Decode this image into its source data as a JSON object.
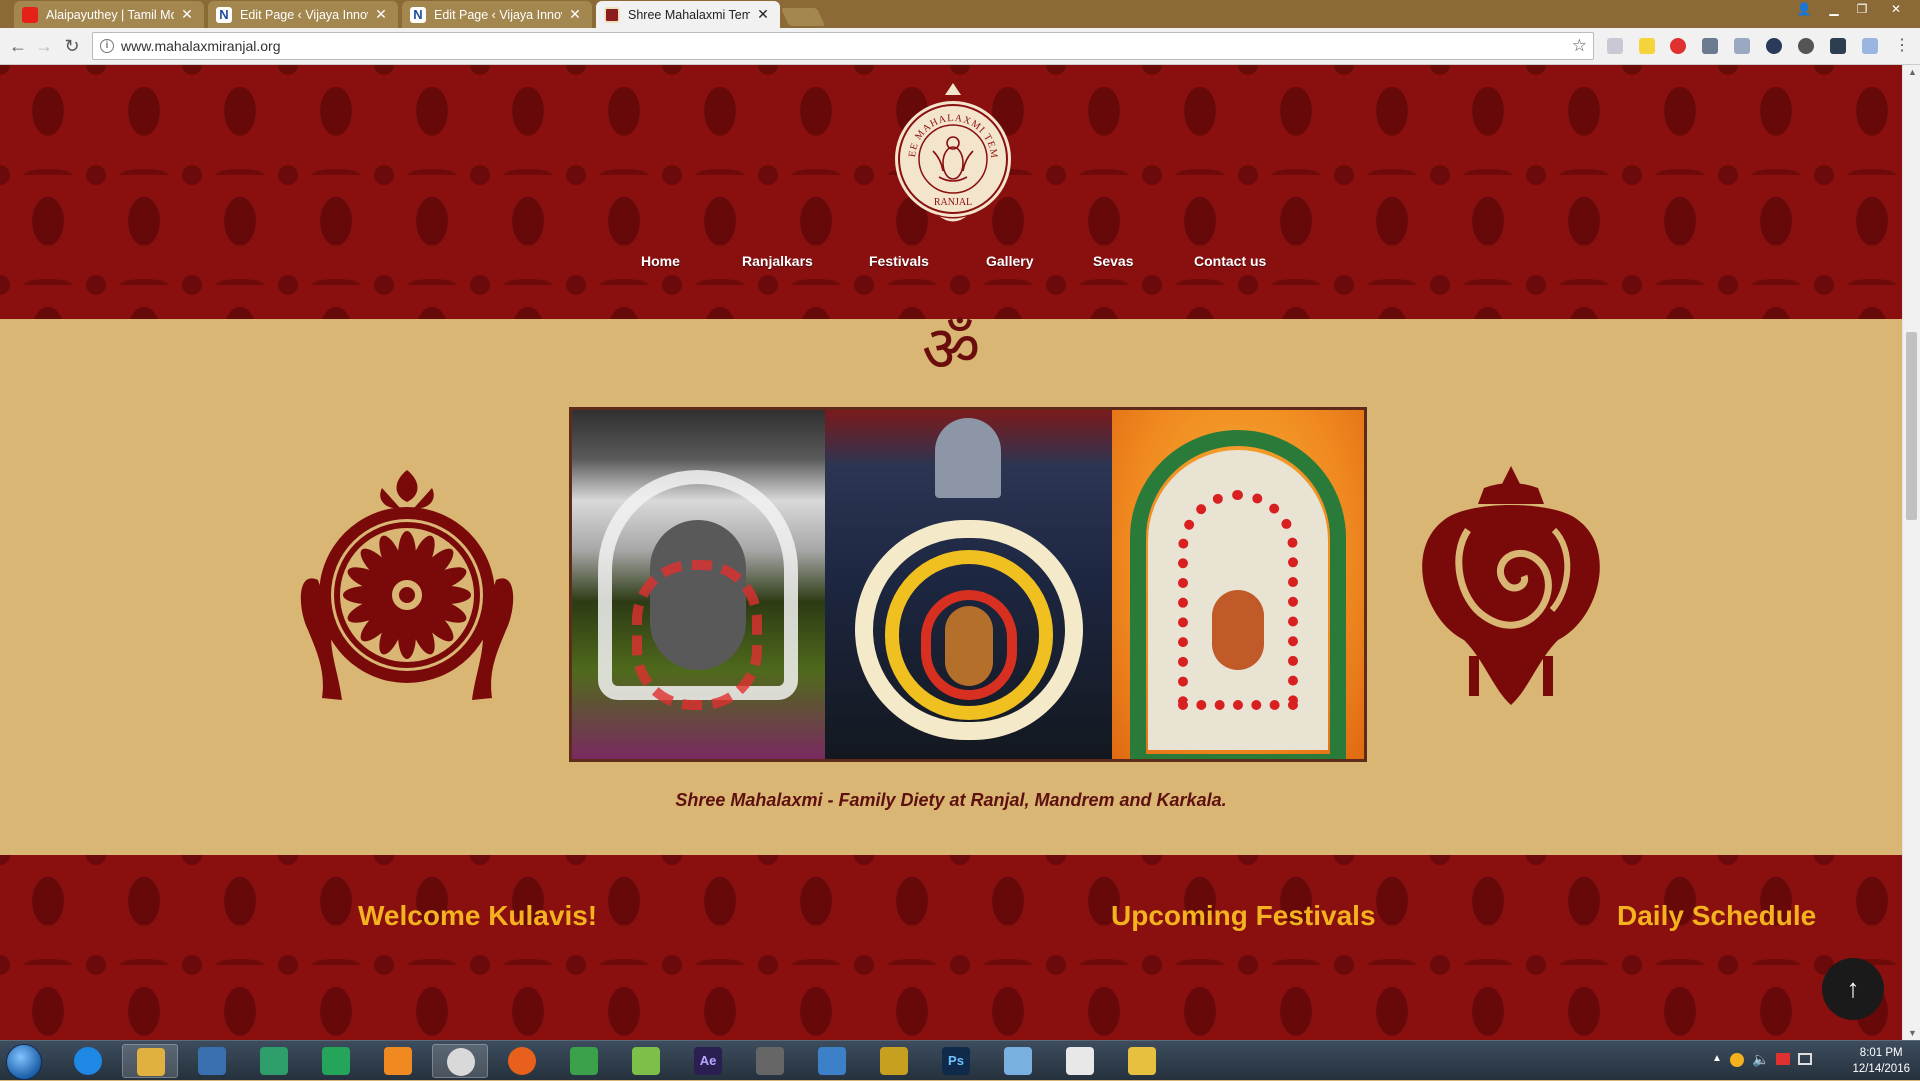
{
  "browser": {
    "tabs": [
      {
        "title": "Alaipayuthey | Tamil Mo",
        "icon": "youtube-favicon"
      },
      {
        "title": "Edit Page ‹ Vijaya Innova",
        "icon": "n-favicon"
      },
      {
        "title": "Edit Page ‹ Vijaya Innova",
        "icon": "n-favicon"
      },
      {
        "title": "Shree Mahalaxmi Templ",
        "icon": "temple-favicon"
      }
    ],
    "tab_close_glyph": "✕",
    "url": "www.mahalaxmiranjal.org"
  },
  "site": {
    "logo": {
      "arc_text": "SHREE MAHALAXMI TEMPLE",
      "bottom_text": "RANJAL"
    },
    "nav": [
      "Home",
      "Ranjalkars",
      "Festivals",
      "Gallery",
      "Sevas",
      "Contact us"
    ],
    "om_symbol": "ॐ",
    "caption": "Shree Mahalaxmi - Family Diety at Ranjal, Mandrem and Karkala.",
    "sections": [
      "Welcome Kulavis!",
      "Upcoming Festivals",
      "Daily Schedule"
    ],
    "back_to_top_glyph": "↑"
  },
  "taskbar": {
    "apps": [
      "ie",
      "explorer",
      "media",
      "sheets",
      "network",
      "vlc",
      "chrome",
      "firefox",
      "notepad-green",
      "charts",
      "Ae",
      "tower",
      "mail",
      "vpn",
      "Ps",
      "eraser",
      "word",
      "folder"
    ],
    "time": "8:01 PM",
    "date": "12/14/2016"
  },
  "colors": {
    "maroon": "#8a1010",
    "beige": "#d9b673",
    "heading_gold": "#f3b21e",
    "caption_text": "#5e1010"
  }
}
